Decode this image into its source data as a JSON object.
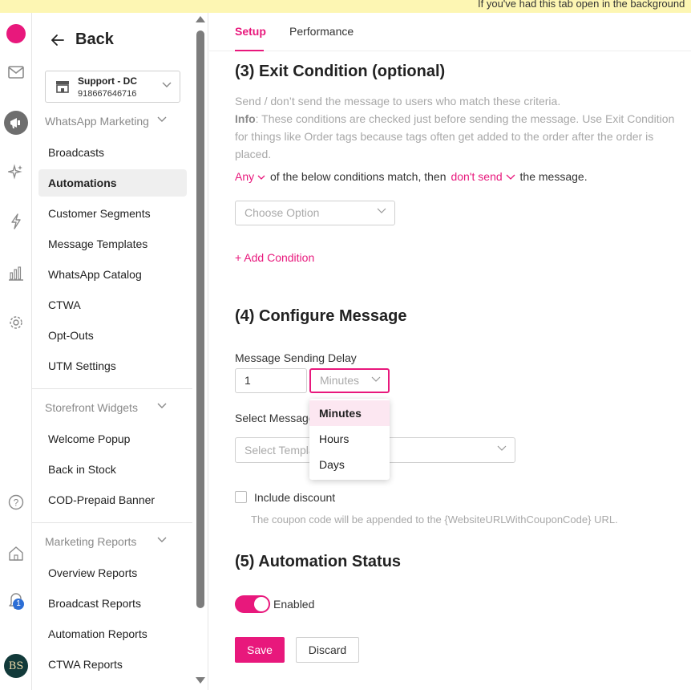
{
  "banner": {
    "text": "If you've had this tab open in the background"
  },
  "iconbar": {
    "icons": [
      "brand-logo-icon",
      "mail-icon",
      "megaphone-icon",
      "sparkles-icon",
      "lightning-icon",
      "bar-chart-icon",
      "gear-icon",
      "help-icon",
      "home-icon",
      "bell-icon"
    ],
    "notification_count": "1",
    "avatar_initials": "BS"
  },
  "sidebar": {
    "back_label": "Back",
    "store": {
      "name": "Support - DC",
      "number": "918667646716"
    },
    "sections": [
      {
        "title": "WhatsApp Marketing",
        "items": [
          "Broadcasts",
          "Automations",
          "Customer Segments",
          "Message Templates",
          "WhatsApp Catalog",
          "CTWA",
          "Opt-Outs",
          "UTM Settings"
        ]
      },
      {
        "title": "Storefront Widgets",
        "items": [
          "Welcome Popup",
          "Back in Stock",
          "COD-Prepaid Banner"
        ]
      },
      {
        "title": "Marketing Reports",
        "items": [
          "Overview Reports",
          "Broadcast Reports",
          "Automation Reports",
          "CTWA Reports"
        ]
      }
    ],
    "active_item": "Automations"
  },
  "tabs": {
    "setup": "Setup",
    "performance": "Performance",
    "active": "Setup"
  },
  "exit": {
    "title": "(3) Exit Condition (optional)",
    "desc": "Send / don’t send the message to users who match these criteria.",
    "info_label": "Info",
    "info_line1": ": These conditions are checked just before sending the message. Use Exit Condition",
    "info_line2": "for things like Order tags because tags often get added to the order after the order is",
    "info_line3": "placed.",
    "any": "Any",
    "mid": "of the below conditions match, then",
    "dont_send": "don't send",
    "end": "the message.",
    "choose_placeholder": "Choose Option",
    "add_condition": "+ Add Condition"
  },
  "configure": {
    "title": "(4) Configure Message",
    "delay_label": "Message Sending Delay",
    "delay_value": "1",
    "unit_placeholder": "Minutes",
    "unit_options": [
      "Minutes",
      "Hours",
      "Days"
    ],
    "unit_highlighted": "Minutes",
    "select_message_label": "Select Message",
    "template_placeholder": "Select Template",
    "include_discount": "Include discount",
    "coupon_hint": "The coupon code will be appended to the {WebsiteURLWithCouponCode} URL."
  },
  "status": {
    "title": "(5) Automation Status",
    "toggle_on": true,
    "toggle_label": "Enabled",
    "save": "Save",
    "discard": "Discard"
  }
}
